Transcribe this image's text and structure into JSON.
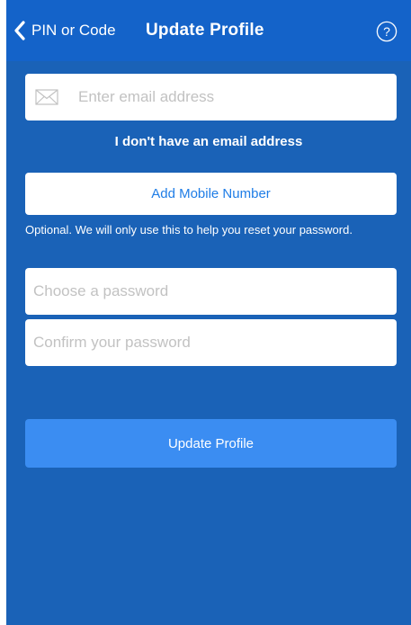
{
  "nav": {
    "back_label": "PIN or Code",
    "title": "Update Profile",
    "back_icon": "chevron-left-icon",
    "help_icon": "question-circle-icon"
  },
  "form": {
    "email_placeholder": "Enter email address",
    "email_icon": "envelope-icon",
    "no_email_link": "I don't have an email address",
    "add_mobile_label": "Add Mobile Number",
    "helper_text": "Optional. We will only use this to help you reset your password.",
    "password_placeholder": "Choose a password",
    "confirm_placeholder": "Confirm your password",
    "submit_label": "Update Profile"
  },
  "colors": {
    "background": "#1a62b7",
    "navbar": "#1463c9",
    "primary_button": "#3b8df2",
    "link": "#1f7de6"
  }
}
